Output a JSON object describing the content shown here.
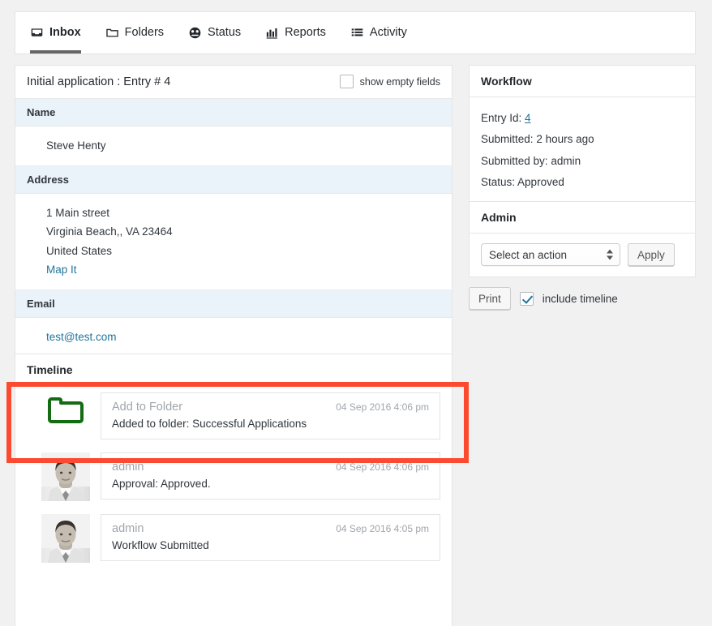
{
  "tabs": [
    {
      "label": "Inbox",
      "icon": "inbox-icon",
      "active": true
    },
    {
      "label": "Folders",
      "icon": "folder-icon",
      "active": false
    },
    {
      "label": "Status",
      "icon": "dashboard-icon",
      "active": false
    },
    {
      "label": "Reports",
      "icon": "bar-chart-icon",
      "active": false
    },
    {
      "label": "Activity",
      "icon": "list-icon",
      "active": false
    }
  ],
  "entry": {
    "title": "Initial application : Entry # 4",
    "show_empty_fields_label": "show empty fields",
    "show_empty_fields_checked": false,
    "sections": [
      {
        "heading": "Name",
        "lines": [
          "Steve Henty"
        ],
        "links": []
      },
      {
        "heading": "Address",
        "lines": [
          "1 Main street",
          "Virginia Beach,, VA 23464",
          "United States"
        ],
        "links": [
          "Map It"
        ]
      },
      {
        "heading": "Email",
        "lines": [],
        "links": [
          "test@test.com"
        ]
      }
    ]
  },
  "workflow": {
    "title": "Workflow",
    "entry_id_label": "Entry Id:",
    "entry_id_value": "4",
    "submitted_label": "Submitted:",
    "submitted_value": "2 hours ago",
    "submitted_by_label": "Submitted by:",
    "submitted_by_value": "admin",
    "status_label": "Status:",
    "status_value": "Approved"
  },
  "admin": {
    "title": "Admin",
    "select_value": "Select an action",
    "apply_label": "Apply"
  },
  "print": {
    "print_label": "Print",
    "include_timeline_label": "include timeline",
    "include_timeline_checked": true
  },
  "timeline": {
    "title": "Timeline",
    "items": [
      {
        "icon": "green-folder-icon",
        "actor": "Add to Folder",
        "date": "04 Sep 2016 4:06 pm",
        "description": "Added to folder: Successful Applications",
        "highlighted": true
      },
      {
        "icon": "user-avatar",
        "actor": "admin",
        "date": "04 Sep 2016 4:06 pm",
        "description": "Approval: Approved.",
        "highlighted": false
      },
      {
        "icon": "user-avatar",
        "actor": "admin",
        "date": "04 Sep 2016 4:05 pm",
        "description": "Workflow Submitted",
        "highlighted": false
      }
    ]
  },
  "colors": {
    "highlight": "#fb4a2f",
    "folder_green": "#136b13",
    "link": "#21759b",
    "section_header_bg": "#eaf2fa"
  }
}
